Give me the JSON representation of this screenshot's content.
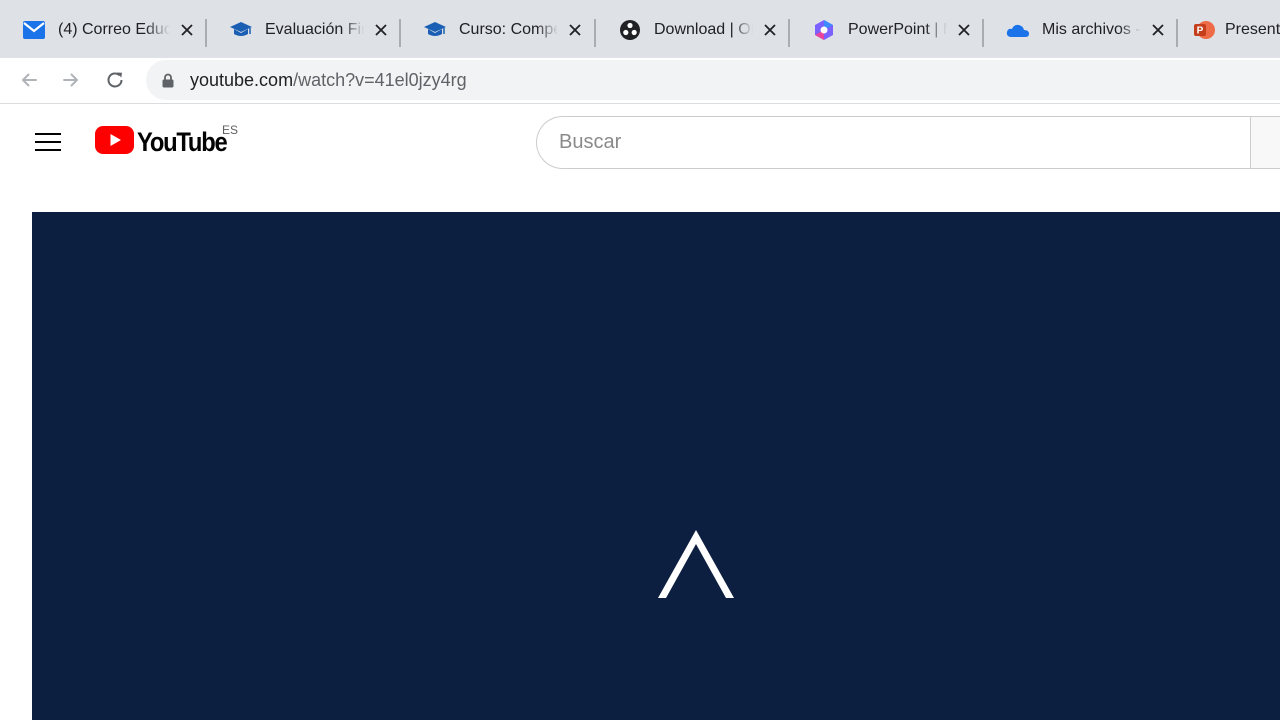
{
  "browser": {
    "tabs": [
      {
        "title": "(4) Correo Educ",
        "favicon": "mail-icon"
      },
      {
        "title": "Evaluación Fin",
        "favicon": "graduation-cap-icon"
      },
      {
        "title": "Curso: Compe",
        "favicon": "graduation-cap-icon"
      },
      {
        "title": "Download | OB",
        "favicon": "obs-icon"
      },
      {
        "title": "PowerPoint | M",
        "favicon": "microsoft365-icon"
      },
      {
        "title": "Mis archivos -",
        "favicon": "onedrive-icon"
      },
      {
        "title": "Present",
        "favicon": "powerpoint-icon"
      }
    ],
    "address": {
      "host": "youtube.com",
      "path": "/watch?v=41el0jzy4rg"
    }
  },
  "youtube": {
    "logo_text": "YouTube",
    "region_code": "ES",
    "search_placeholder": "Buscar"
  },
  "colors": {
    "tab_strip": "#dee1e6",
    "youtube_red": "#ff0000",
    "player_background": "#0d1f40",
    "gmail_blue": "#1a73e8"
  }
}
